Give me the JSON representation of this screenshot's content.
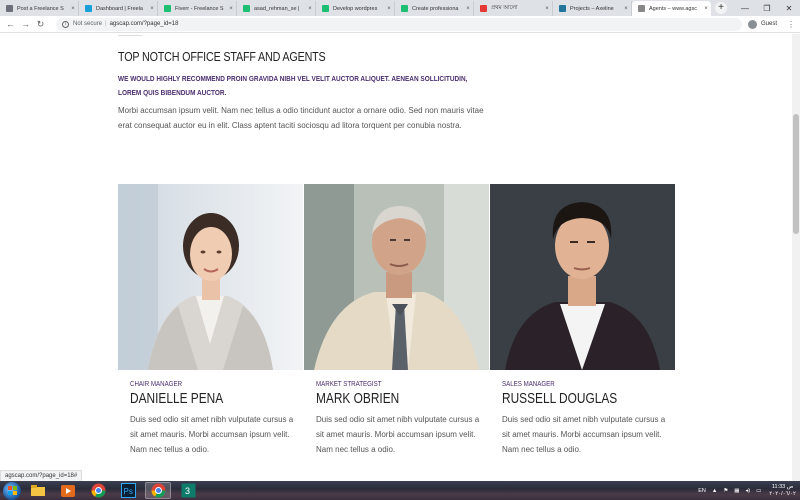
{
  "browser": {
    "tabs": [
      {
        "label": "Post a Freelance S",
        "favicon_color": "#6b6f7a"
      },
      {
        "label": "Dashboard | Freela",
        "favicon_color": "#1aa0d8"
      },
      {
        "label": "Fiverr - Freelance S",
        "favicon_color": "#1dbf73"
      },
      {
        "label": "asad_rehman_se |",
        "favicon_color": "#1dbf73"
      },
      {
        "label": "Develop wordpres",
        "favicon_color": "#1dbf73"
      },
      {
        "label": "Create professiona",
        "favicon_color": "#1dbf73"
      },
      {
        "label": "প্রথম আলো",
        "favicon_color": "#e53935"
      },
      {
        "label": "Projects – Axeline",
        "favicon_color": "#21759b"
      },
      {
        "label": "Agents – www.agsc",
        "favicon_color": "#888888",
        "active": true
      }
    ],
    "new_tab_symbol": "+",
    "address": {
      "security_label": "Not secure",
      "url": "agscap.com/?page_id=18"
    },
    "profile_label": "Guest",
    "status_url": "agscap.com/?page_id=18#"
  },
  "page": {
    "heading": "TOP NOTCH OFFICE STAFF AND AGENTS",
    "subheading": "WE WOULD HIGHLY RECOMMEND PROIN GRAVIDA NIBH VEL VELIT AUCTOR ALIQUET. AENEAN SOLLICITUDIN, LOREM QUIS BIBENDUM AUCTOR.",
    "intro": "Morbi accumsan ipsum velit. Nam nec tellus a odio tincidunt auctor a ornare odio. Sed non mauris vitae erat consequat auctor eu in elit. Class aptent taciti sociosqu ad litora torquent per conubia nostra.",
    "agents": [
      {
        "role": "CHAIR MANAGER",
        "name": "DANIELLE PENA",
        "bio": "Duis sed odio sit amet nibh vulputate cursus a sit amet mauris. Morbi accumsan ipsum velit. Nam nec tellus a odio."
      },
      {
        "role": "MARKET STRATEGIST",
        "name": "MARK OBRIEN",
        "bio": "Duis sed odio sit amet nibh vulputate cursus a sit amet mauris. Morbi accumsan ipsum velit. Nam nec tellus a odio."
      },
      {
        "role": "SALES MANAGER",
        "name": "RUSSELL DOUGLAS",
        "bio": "Duis sed odio sit amet nibh vulputate cursus a sit amet mauris. Morbi accumsan ipsum velit. Nam nec tellus a odio."
      }
    ]
  },
  "taskbar": {
    "apps": [
      "file-explorer-icon",
      "media-player-icon",
      "chrome-icon",
      "photoshop-icon",
      "chrome-icon",
      "app-icon"
    ],
    "tray": {
      "language": "EN",
      "time": "11:33 ص",
      "date": "٢٠٢٠/٠٦/٠٢"
    }
  },
  "colors": {
    "accent": "#4b2e6f",
    "text": "#555555",
    "heading": "#222222"
  }
}
